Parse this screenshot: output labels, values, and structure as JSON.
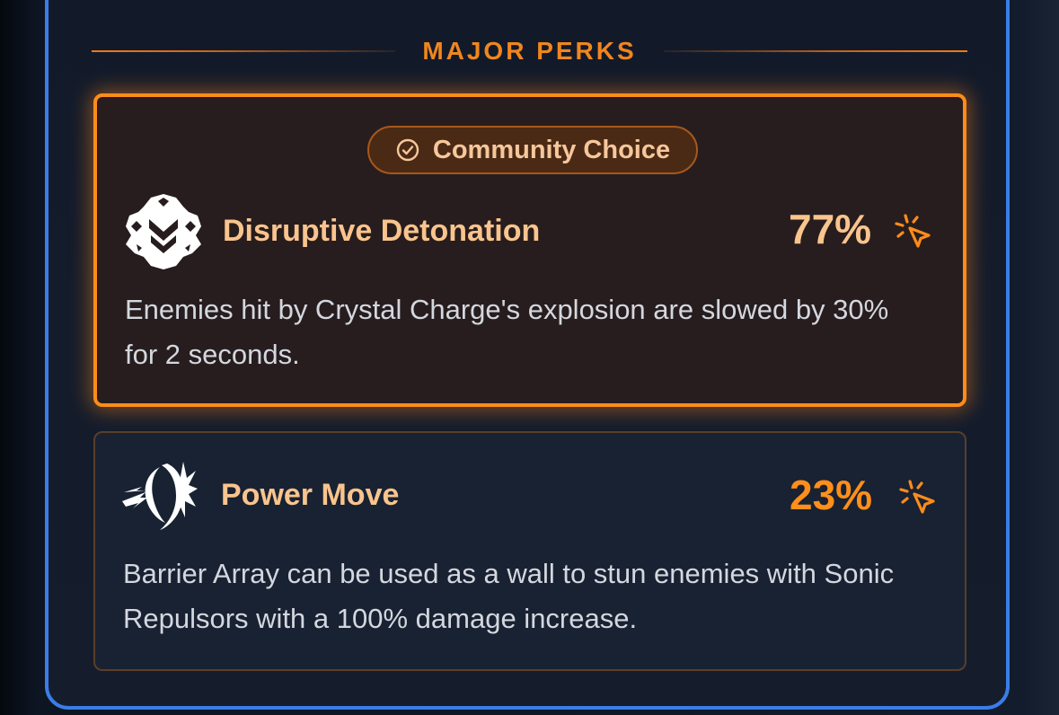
{
  "section": {
    "title": "MAJOR PERKS"
  },
  "perks": [
    {
      "badge": "Community Choice",
      "badge_icon": "check-circle-icon",
      "icon": "crystal-burst-icon",
      "name": "Disruptive Detonation",
      "percent": "77%",
      "vote_icon": "cursor-click-icon",
      "description": "Enemies hit by Crystal Charge's explosion are slowed by 30% for 2 seconds.",
      "selected": true
    },
    {
      "icon": "sonic-ring-icon",
      "name": "Power Move",
      "percent": "23%",
      "vote_icon": "cursor-click-icon",
      "description": "Barrier Array can be used as a wall to stun enemies with Sonic Repulsors with a 100% damage increase.",
      "selected": false
    }
  ],
  "colors": {
    "accent": "#ff8c1a",
    "panel_border": "#3a7de8",
    "text": "#d4d7de",
    "title": "#f9c48d"
  }
}
